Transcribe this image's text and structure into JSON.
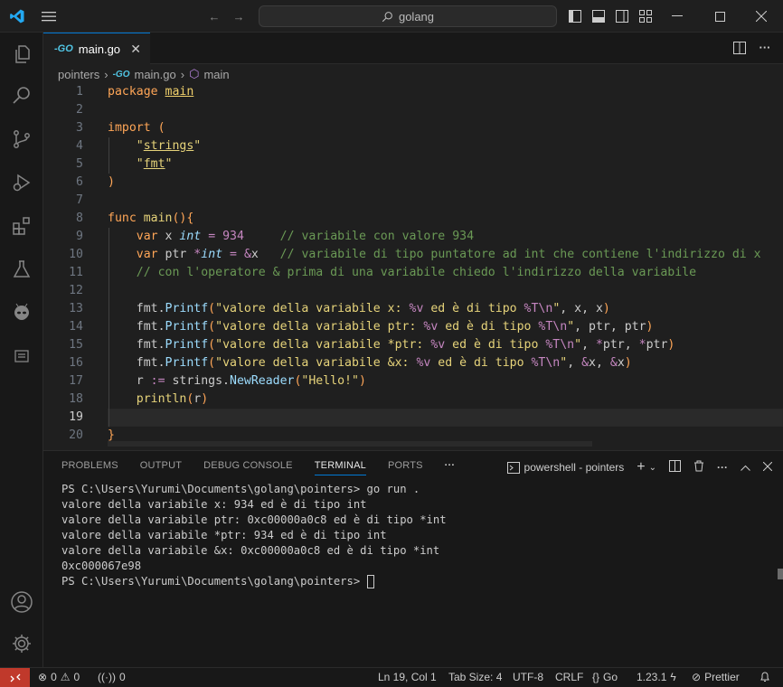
{
  "search": {
    "text": "golang"
  },
  "tab": {
    "label": "main.go"
  },
  "breadcrumb": {
    "folder": "pointers",
    "file": "main.go",
    "symbol": "main"
  },
  "editor": {
    "line_numbers": [
      "1",
      "2",
      "3",
      "4",
      "5",
      "6",
      "7",
      "8",
      "9",
      "10",
      "11",
      "12",
      "13",
      "14",
      "15",
      "16",
      "17",
      "18",
      "19",
      "20"
    ],
    "active_line": "19"
  },
  "panel": {
    "tabs": [
      "PROBLEMS",
      "OUTPUT",
      "DEBUG CONSOLE",
      "TERMINAL",
      "PORTS"
    ],
    "active_tab": "TERMINAL",
    "terminal_name": "powershell - pointers",
    "terminal_lines": [
      "PS C:\\Users\\Yurumi\\Documents\\golang\\pointers> go run .",
      "valore della variabile x: 934 ed è di tipo int",
      "valore della variabile ptr: 0xc00000a0c8 ed è di tipo *int",
      "valore della variabile *ptr: 934 ed è di tipo int",
      "valore della variabile &x: 0xc00000a0c8 ed è di tipo *int",
      "0xc000067e98"
    ],
    "prompt": "PS C:\\Users\\Yurumi\\Documents\\golang\\pointers> "
  },
  "status": {
    "errors": "0",
    "warnings": "0",
    "ports": "0",
    "position": "Ln 19, Col 1",
    "tab_size": "Tab Size: 4",
    "encoding": "UTF-8",
    "eol": "CRLF",
    "language": "Go",
    "go_version": "1.23.1",
    "formatter": "Prettier"
  },
  "colors": {
    "accent": "#0078d4",
    "remote": "#c0392b"
  }
}
